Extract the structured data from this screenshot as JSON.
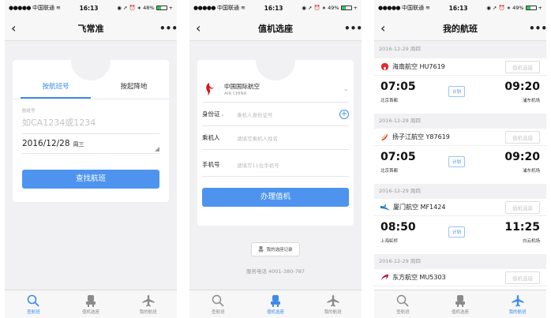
{
  "status": {
    "carrier": "中国联通",
    "time": "16:13",
    "battery_p1": "48%",
    "battery_p2": "49%",
    "battery_p3": "49%",
    "battery_fill_p1": 0.48,
    "battery_fill_p2": 0.49,
    "battery_fill_p3": 0.49
  },
  "colors": {
    "accent": "#3d8bef",
    "button": "#4e94ef",
    "air_china": "#d7141a",
    "hainan": "#e3292e",
    "sichuan": "#e8412c",
    "xiamen": "#2677c8",
    "china_eastern": "#b5122a"
  },
  "tabs": [
    {
      "label": "查航班",
      "icon": "search-icon"
    },
    {
      "label": "值机选座",
      "icon": "seat-icon"
    },
    {
      "label": "我的航班",
      "icon": "plane-icon"
    }
  ],
  "phone1": {
    "nav_title": "飞常准",
    "seg_by_flight": "按航班号",
    "seg_by_city": "按起降地",
    "flight_label": "航班号",
    "flight_placeholder": "如CA1234或1234",
    "date": "2016/12/28",
    "weekday": "周三",
    "search_button": "查找航班"
  },
  "phone2": {
    "nav_title": "值机选座",
    "airline_cn": "中国国际航空",
    "airline_en": "AIR CHINA",
    "id_label": "身份证",
    "id_placeholder": "乘机人身份证号",
    "name_label": "乘机人",
    "name_placeholder": "请填写乘机人姓名",
    "phone_label": "手机号",
    "phone_placeholder": "请填写11位手机号",
    "checkin_button": "办理值机",
    "record_button": "我的选座记录",
    "service_phone": "服务电话 4001-380-787"
  },
  "phone3": {
    "nav_title": "我的航班",
    "select_label": "值机选座",
    "badge": "计划",
    "flights": [
      {
        "date": "2016-12-29 周四",
        "airline": "海南航空 HU7619",
        "dep_time": "07:05",
        "dep_airport": "北京首都",
        "arr_time": "09:20",
        "arr_airport": "浦东机场"
      },
      {
        "date": "2016-12-29 周四",
        "airline": "扬子江航空 Y87619",
        "dep_time": "07:05",
        "dep_airport": "北京首都",
        "arr_time": "09:20",
        "arr_airport": "浦东机场"
      },
      {
        "date": "2016-12-29 周四",
        "airline": "厦门航空 MF1424",
        "dep_time": "08:50",
        "dep_airport": "上海虹桥",
        "arr_time": "11:25",
        "arr_airport": "白云机场"
      },
      {
        "date": "2016-12-29 周四",
        "airline": "东方航空 MU5303"
      }
    ]
  }
}
